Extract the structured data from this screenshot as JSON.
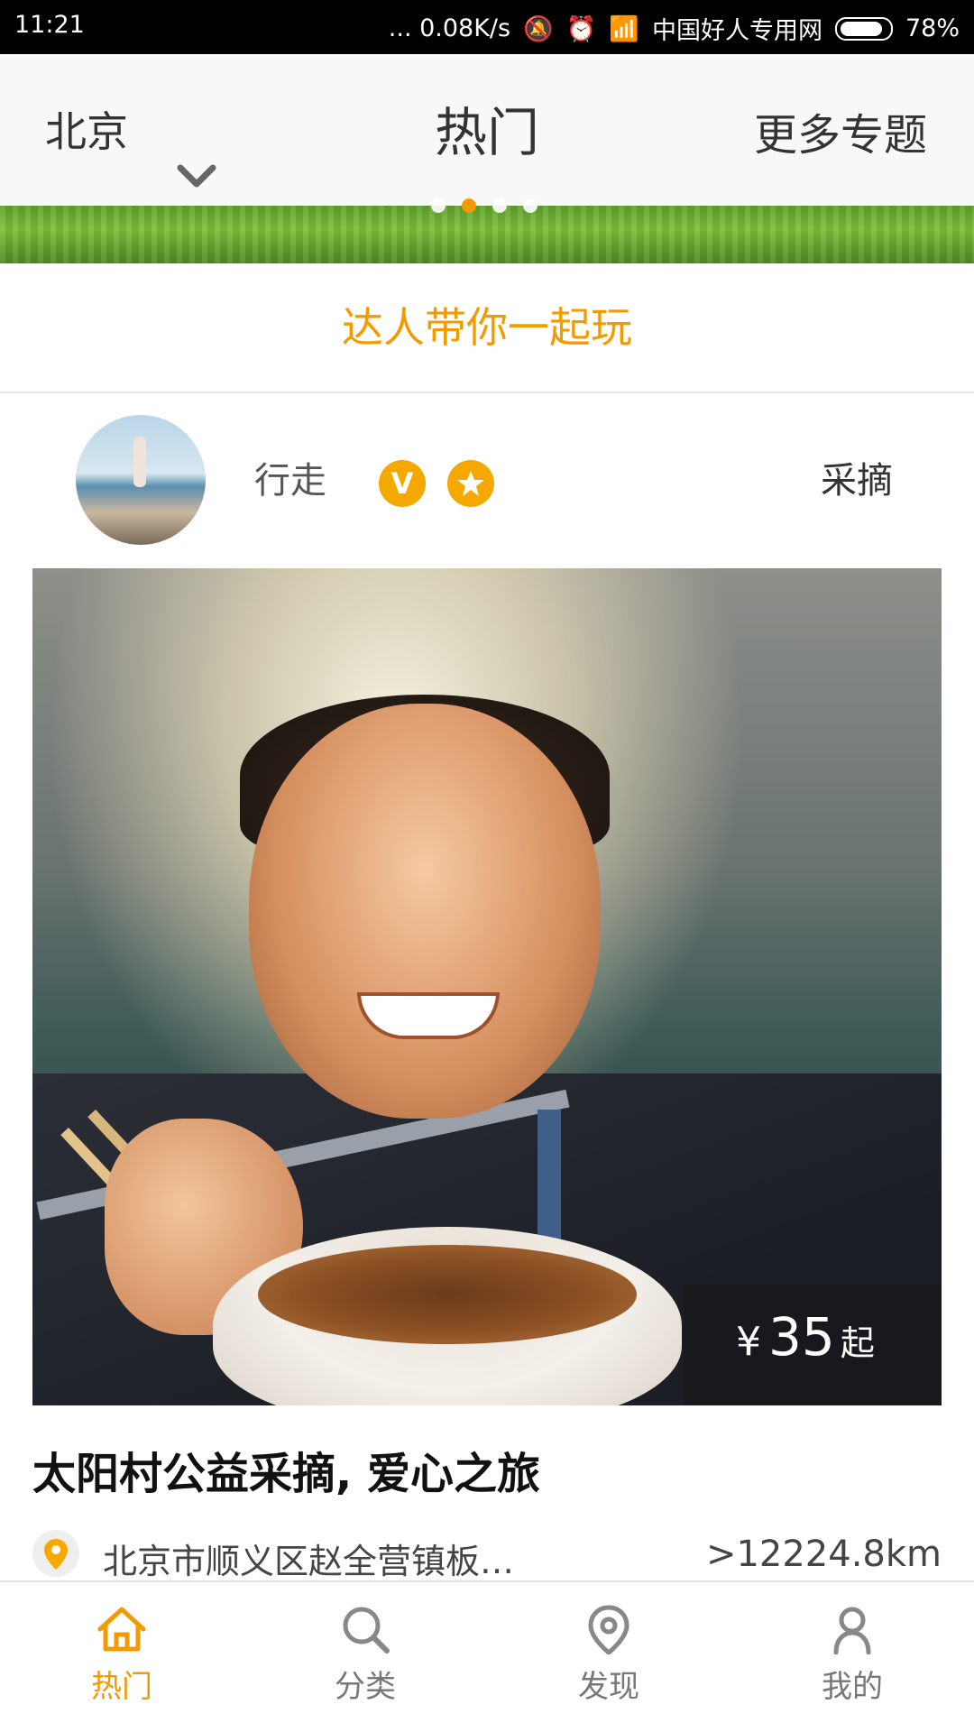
{
  "status_bar": {
    "time": "11:21",
    "network_speed": "... 0.08K/s",
    "carrier": "中国好人专用网",
    "battery": "78%"
  },
  "header": {
    "city": "北京",
    "title": "热门",
    "more": "更多专题"
  },
  "banner": {
    "dots": 4,
    "active_dot": 2
  },
  "section": {
    "title": "达人带你一起玩"
  },
  "author": {
    "name": "行走",
    "badge_v": "V",
    "tag": "采摘"
  },
  "item": {
    "price_currency": "¥",
    "price_value": "35",
    "price_suffix": "起",
    "title": "太阳村公益采摘, 爱心之旅",
    "address": "北京市顺义区赵全营镇板…",
    "distance": ">12224.8km"
  },
  "bottom_nav": [
    {
      "label": "热门",
      "icon": "home-icon",
      "active": true
    },
    {
      "label": "分类",
      "icon": "search-icon",
      "active": false
    },
    {
      "label": "发现",
      "icon": "location-pin-icon",
      "active": false
    },
    {
      "label": "我的",
      "icon": "user-icon",
      "active": false
    }
  ],
  "colors": {
    "accent": "#f39a00",
    "badge": "#f5a800",
    "text_dark": "#333333"
  }
}
